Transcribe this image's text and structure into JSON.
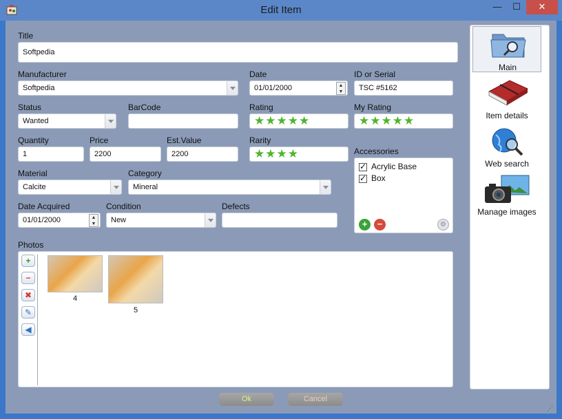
{
  "window": {
    "title": "Edit Item",
    "minimize": "—",
    "maximize": "☐",
    "close": "✕"
  },
  "form": {
    "title_label": "Title",
    "title_value": "Softpedia",
    "manufacturer_label": "Manufacturer",
    "manufacturer_value": "Softpedia",
    "date_label": "Date",
    "date_value": "01/01/2000",
    "id_label": "ID or Serial",
    "id_value": "TSC #5162",
    "status_label": "Status",
    "status_value": "Wanted",
    "barcode_label": "BarCode",
    "barcode_value": "",
    "rating_label": "Rating",
    "rating_value": 5,
    "myrating_label": "My Rating",
    "myrating_value": 5,
    "quantity_label": "Quantity",
    "quantity_value": "1",
    "price_label": "Price",
    "price_value": "2200",
    "estvalue_label": "Est.Value",
    "estvalue_value": "2200",
    "rarity_label": "Rarity",
    "rarity_value": 4,
    "material_label": "Material",
    "material_value": "Calcite",
    "category_label": "Category",
    "category_value": "Mineral",
    "accessories_label": "Accessories",
    "accessories": [
      {
        "label": "Acrylic Base",
        "checked": true
      },
      {
        "label": "Box",
        "checked": true
      }
    ],
    "dateacq_label": "Date Acquired",
    "dateacq_value": "01/01/2000",
    "condition_label": "Condition",
    "condition_value": "New",
    "defects_label": "Defects",
    "defects_value": "",
    "photos_label": "Photos",
    "photos": [
      {
        "caption": "4"
      },
      {
        "caption": "5"
      }
    ]
  },
  "nav": [
    {
      "label": "Main",
      "icon": "folder-search-icon",
      "selected": true
    },
    {
      "label": "Item details",
      "icon": "book-icon"
    },
    {
      "label": "Web search",
      "icon": "globe-search-icon"
    },
    {
      "label": "Manage images",
      "icon": "camera-icon"
    }
  ],
  "buttons": {
    "ok": "Ok",
    "cancel": "Cancel"
  },
  "colors": {
    "titlebar": "#5b87c8",
    "client": "#8b9bb7",
    "star": "#4fb52d",
    "close": "#c7504a"
  }
}
